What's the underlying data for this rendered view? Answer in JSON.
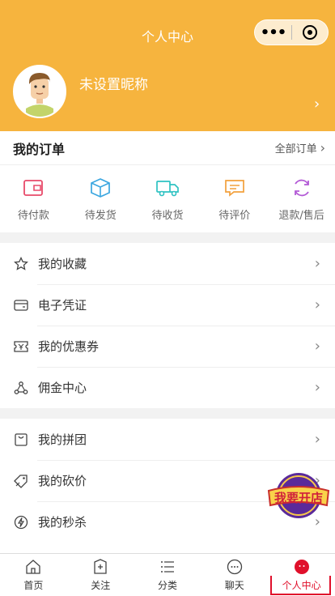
{
  "header": {
    "title": "个人中心",
    "nickname": "未设置昵称",
    "capsule_more": "•••"
  },
  "orders": {
    "title": "我的订单",
    "all_label": "全部订单",
    "items": [
      {
        "label": "待付款",
        "icon": "wallet-icon",
        "color": "#e84a6a"
      },
      {
        "label": "待发货",
        "icon": "box-icon",
        "color": "#3aa6e0"
      },
      {
        "label": "待收货",
        "icon": "truck-icon",
        "color": "#2ec2c2"
      },
      {
        "label": "待评价",
        "icon": "comment-icon",
        "color": "#f2a03c"
      },
      {
        "label": "退款/售后",
        "icon": "refresh-icon",
        "color": "#b35ad6"
      }
    ]
  },
  "menu1": [
    {
      "label": "我的收藏",
      "icon": "star-icon"
    },
    {
      "label": "电子凭证",
      "icon": "card-icon"
    },
    {
      "label": "我的优惠券",
      "icon": "coupon-icon"
    },
    {
      "label": "佣金中心",
      "icon": "network-icon"
    }
  ],
  "menu2": [
    {
      "label": "我的拼团",
      "icon": "bag-icon"
    },
    {
      "label": "我的砍价",
      "icon": "tag-icon"
    },
    {
      "label": "我的秒杀",
      "icon": "bolt-icon"
    }
  ],
  "badge": {
    "text": "我要开店"
  },
  "tabbar": [
    {
      "label": "首页",
      "icon": "home-icon"
    },
    {
      "label": "关注",
      "icon": "follow-icon"
    },
    {
      "label": "分类",
      "icon": "list-icon"
    },
    {
      "label": "聊天",
      "icon": "chat-icon"
    },
    {
      "label": "个人中心",
      "icon": "profile-icon",
      "active": true
    }
  ],
  "colors": {
    "header": "#f6b43e",
    "active": "#e0102b"
  }
}
